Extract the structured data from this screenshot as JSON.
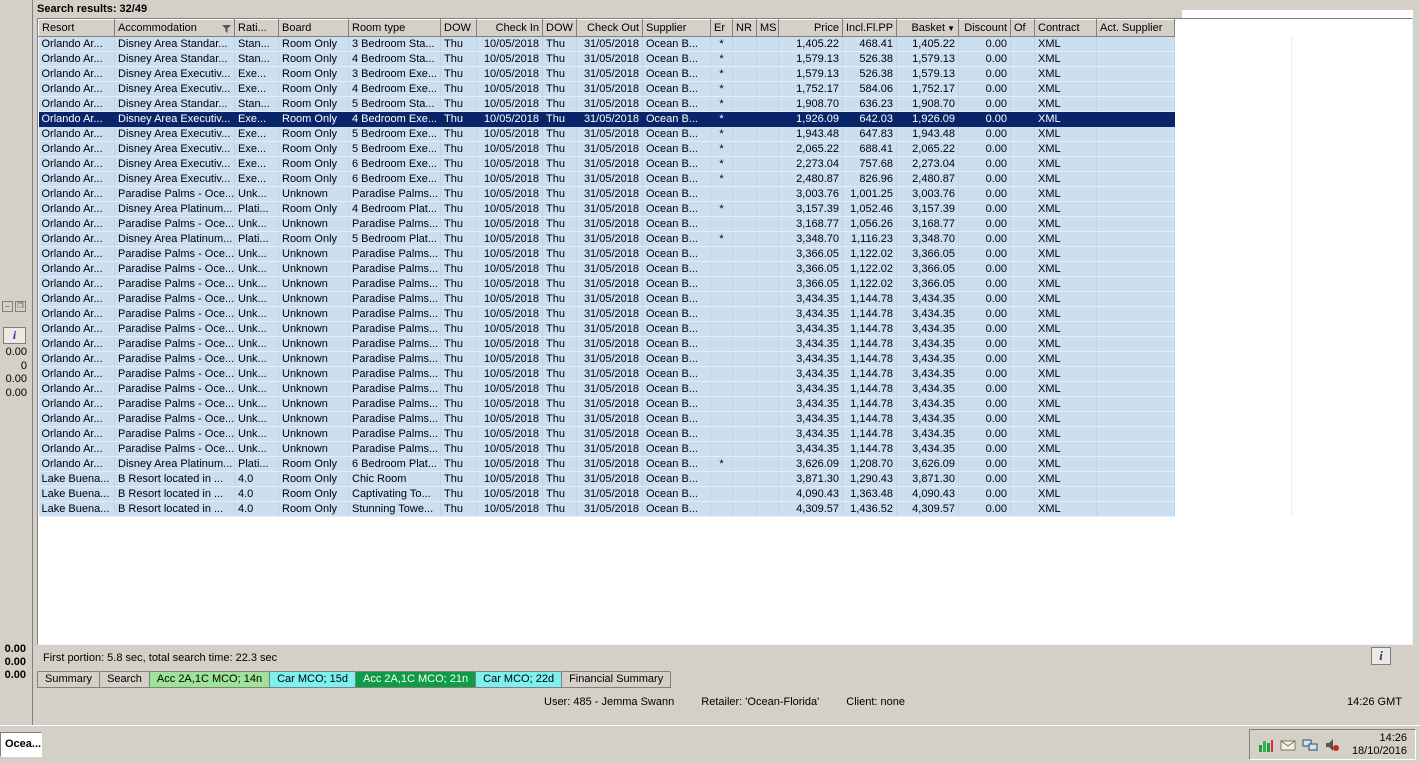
{
  "header": {
    "title": "Search results: 32/49"
  },
  "left_panel": {
    "info_button_label": "i",
    "pin_icon": "panel-pin-icon",
    "restore_icon": "panel-restore-icon",
    "values": [
      "0.00",
      "0",
      "0.00",
      "0.00"
    ],
    "totals": [
      "0.00",
      "0.00",
      "0.00"
    ]
  },
  "table": {
    "columns": [
      {
        "label": "Resort",
        "width": 76,
        "align": "left"
      },
      {
        "label": "Accommodation",
        "width": 120,
        "align": "left",
        "filter_icon": true
      },
      {
        "label": "Rati...",
        "width": 44,
        "align": "left"
      },
      {
        "label": "Board",
        "width": 70,
        "align": "left"
      },
      {
        "label": "Room type",
        "width": 92,
        "align": "left"
      },
      {
        "label": "DOW",
        "width": 36,
        "align": "left"
      },
      {
        "label": "Check In",
        "width": 66,
        "align": "right"
      },
      {
        "label": "DOW",
        "width": 34,
        "align": "left"
      },
      {
        "label": "Check Out",
        "width": 66,
        "align": "right"
      },
      {
        "label": "Supplier",
        "width": 68,
        "align": "left"
      },
      {
        "label": "Er",
        "width": 22,
        "align": "center"
      },
      {
        "label": "NR",
        "width": 24,
        "align": "center"
      },
      {
        "label": "MS",
        "width": 22,
        "align": "center"
      },
      {
        "label": "Price",
        "width": 64,
        "align": "right"
      },
      {
        "label": "Incl.Fl.PP",
        "width": 54,
        "align": "right"
      },
      {
        "label": "Basket",
        "width": 62,
        "align": "right",
        "sort_icon": true
      },
      {
        "label": "Discount",
        "width": 52,
        "align": "right"
      },
      {
        "label": "Of",
        "width": 24,
        "align": "left"
      },
      {
        "label": "Contract",
        "width": 62,
        "align": "left"
      },
      {
        "label": "Act. Supplier",
        "width": 78,
        "align": "left"
      }
    ],
    "selected_row_index": 5,
    "rows": [
      [
        "Orlando Ar...",
        "Disney Area Standar...",
        "Stan...",
        "Room Only",
        "3 Bedroom Sta...",
        "Thu",
        "10/05/2018",
        "Thu",
        "31/05/2018",
        "Ocean B...",
        "*",
        "",
        "",
        "1,405.22",
        "468.41",
        "1,405.22",
        "0.00",
        "",
        "XML",
        ""
      ],
      [
        "Orlando Ar...",
        "Disney Area Standar...",
        "Stan...",
        "Room Only",
        "4 Bedroom Sta...",
        "Thu",
        "10/05/2018",
        "Thu",
        "31/05/2018",
        "Ocean B...",
        "*",
        "",
        "",
        "1,579.13",
        "526.38",
        "1,579.13",
        "0.00",
        "",
        "XML",
        ""
      ],
      [
        "Orlando Ar...",
        "Disney Area Executiv...",
        "Exe...",
        "Room Only",
        "3 Bedroom Exe...",
        "Thu",
        "10/05/2018",
        "Thu",
        "31/05/2018",
        "Ocean B...",
        "*",
        "",
        "",
        "1,579.13",
        "526.38",
        "1,579.13",
        "0.00",
        "",
        "XML",
        ""
      ],
      [
        "Orlando Ar...",
        "Disney Area Executiv...",
        "Exe...",
        "Room Only",
        "4 Bedroom Exe...",
        "Thu",
        "10/05/2018",
        "Thu",
        "31/05/2018",
        "Ocean B...",
        "*",
        "",
        "",
        "1,752.17",
        "584.06",
        "1,752.17",
        "0.00",
        "",
        "XML",
        ""
      ],
      [
        "Orlando Ar...",
        "Disney Area Standar...",
        "Stan...",
        "Room Only",
        "5 Bedroom Sta...",
        "Thu",
        "10/05/2018",
        "Thu",
        "31/05/2018",
        "Ocean B...",
        "*",
        "",
        "",
        "1,908.70",
        "636.23",
        "1,908.70",
        "0.00",
        "",
        "XML",
        ""
      ],
      [
        "Orlando Ar...",
        "Disney Area Executiv...",
        "Exe...",
        "Room Only",
        "4 Bedroom Exe...",
        "Thu",
        "10/05/2018",
        "Thu",
        "31/05/2018",
        "Ocean B...",
        "*",
        "",
        "",
        "1,926.09",
        "642.03",
        "1,926.09",
        "0.00",
        "",
        "XML",
        ""
      ],
      [
        "Orlando Ar...",
        "Disney Area Executiv...",
        "Exe...",
        "Room Only",
        "5 Bedroom Exe...",
        "Thu",
        "10/05/2018",
        "Thu",
        "31/05/2018",
        "Ocean B...",
        "*",
        "",
        "",
        "1,943.48",
        "647.83",
        "1,943.48",
        "0.00",
        "",
        "XML",
        ""
      ],
      [
        "Orlando Ar...",
        "Disney Area Executiv...",
        "Exe...",
        "Room Only",
        "5 Bedroom Exe...",
        "Thu",
        "10/05/2018",
        "Thu",
        "31/05/2018",
        "Ocean B...",
        "*",
        "",
        "",
        "2,065.22",
        "688.41",
        "2,065.22",
        "0.00",
        "",
        "XML",
        ""
      ],
      [
        "Orlando Ar...",
        "Disney Area Executiv...",
        "Exe...",
        "Room Only",
        "6 Bedroom Exe...",
        "Thu",
        "10/05/2018",
        "Thu",
        "31/05/2018",
        "Ocean B...",
        "*",
        "",
        "",
        "2,273.04",
        "757.68",
        "2,273.04",
        "0.00",
        "",
        "XML",
        ""
      ],
      [
        "Orlando Ar...",
        "Disney Area Executiv...",
        "Exe...",
        "Room Only",
        "6 Bedroom Exe...",
        "Thu",
        "10/05/2018",
        "Thu",
        "31/05/2018",
        "Ocean B...",
        "*",
        "",
        "",
        "2,480.87",
        "826.96",
        "2,480.87",
        "0.00",
        "",
        "XML",
        ""
      ],
      [
        "Orlando Ar...",
        "Paradise Palms - Oce...",
        "Unk...",
        "Unknown",
        "Paradise Palms...",
        "Thu",
        "10/05/2018",
        "Thu",
        "31/05/2018",
        "Ocean B...",
        "",
        "",
        "",
        "3,003.76",
        "1,001.25",
        "3,003.76",
        "0.00",
        "",
        "XML",
        ""
      ],
      [
        "Orlando Ar...",
        "Disney Area Platinum...",
        "Plati...",
        "Room Only",
        "4 Bedroom Plat...",
        "Thu",
        "10/05/2018",
        "Thu",
        "31/05/2018",
        "Ocean B...",
        "*",
        "",
        "",
        "3,157.39",
        "1,052.46",
        "3,157.39",
        "0.00",
        "",
        "XML",
        ""
      ],
      [
        "Orlando Ar...",
        "Paradise Palms - Oce...",
        "Unk...",
        "Unknown",
        "Paradise Palms...",
        "Thu",
        "10/05/2018",
        "Thu",
        "31/05/2018",
        "Ocean B...",
        "",
        "",
        "",
        "3,168.77",
        "1,056.26",
        "3,168.77",
        "0.00",
        "",
        "XML",
        ""
      ],
      [
        "Orlando Ar...",
        "Disney Area Platinum...",
        "Plati...",
        "Room Only",
        "5 Bedroom Plat...",
        "Thu",
        "10/05/2018",
        "Thu",
        "31/05/2018",
        "Ocean B...",
        "*",
        "",
        "",
        "3,348.70",
        "1,116.23",
        "3,348.70",
        "0.00",
        "",
        "XML",
        ""
      ],
      [
        "Orlando Ar...",
        "Paradise Palms - Oce...",
        "Unk...",
        "Unknown",
        "Paradise Palms...",
        "Thu",
        "10/05/2018",
        "Thu",
        "31/05/2018",
        "Ocean B...",
        "",
        "",
        "",
        "3,366.05",
        "1,122.02",
        "3,366.05",
        "0.00",
        "",
        "XML",
        ""
      ],
      [
        "Orlando Ar...",
        "Paradise Palms - Oce...",
        "Unk...",
        "Unknown",
        "Paradise Palms...",
        "Thu",
        "10/05/2018",
        "Thu",
        "31/05/2018",
        "Ocean B...",
        "",
        "",
        "",
        "3,366.05",
        "1,122.02",
        "3,366.05",
        "0.00",
        "",
        "XML",
        ""
      ],
      [
        "Orlando Ar...",
        "Paradise Palms - Oce...",
        "Unk...",
        "Unknown",
        "Paradise Palms...",
        "Thu",
        "10/05/2018",
        "Thu",
        "31/05/2018",
        "Ocean B...",
        "",
        "",
        "",
        "3,366.05",
        "1,122.02",
        "3,366.05",
        "0.00",
        "",
        "XML",
        ""
      ],
      [
        "Orlando Ar...",
        "Paradise Palms - Oce...",
        "Unk...",
        "Unknown",
        "Paradise Palms...",
        "Thu",
        "10/05/2018",
        "Thu",
        "31/05/2018",
        "Ocean B...",
        "",
        "",
        "",
        "3,434.35",
        "1,144.78",
        "3,434.35",
        "0.00",
        "",
        "XML",
        ""
      ],
      [
        "Orlando Ar...",
        "Paradise Palms - Oce...",
        "Unk...",
        "Unknown",
        "Paradise Palms...",
        "Thu",
        "10/05/2018",
        "Thu",
        "31/05/2018",
        "Ocean B...",
        "",
        "",
        "",
        "3,434.35",
        "1,144.78",
        "3,434.35",
        "0.00",
        "",
        "XML",
        ""
      ],
      [
        "Orlando Ar...",
        "Paradise Palms - Oce...",
        "Unk...",
        "Unknown",
        "Paradise Palms...",
        "Thu",
        "10/05/2018",
        "Thu",
        "31/05/2018",
        "Ocean B...",
        "",
        "",
        "",
        "3,434.35",
        "1,144.78",
        "3,434.35",
        "0.00",
        "",
        "XML",
        ""
      ],
      [
        "Orlando Ar...",
        "Paradise Palms - Oce...",
        "Unk...",
        "Unknown",
        "Paradise Palms...",
        "Thu",
        "10/05/2018",
        "Thu",
        "31/05/2018",
        "Ocean B...",
        "",
        "",
        "",
        "3,434.35",
        "1,144.78",
        "3,434.35",
        "0.00",
        "",
        "XML",
        ""
      ],
      [
        "Orlando Ar...",
        "Paradise Palms - Oce...",
        "Unk...",
        "Unknown",
        "Paradise Palms...",
        "Thu",
        "10/05/2018",
        "Thu",
        "31/05/2018",
        "Ocean B...",
        "",
        "",
        "",
        "3,434.35",
        "1,144.78",
        "3,434.35",
        "0.00",
        "",
        "XML",
        ""
      ],
      [
        "Orlando Ar...",
        "Paradise Palms - Oce...",
        "Unk...",
        "Unknown",
        "Paradise Palms...",
        "Thu",
        "10/05/2018",
        "Thu",
        "31/05/2018",
        "Ocean B...",
        "",
        "",
        "",
        "3,434.35",
        "1,144.78",
        "3,434.35",
        "0.00",
        "",
        "XML",
        ""
      ],
      [
        "Orlando Ar...",
        "Paradise Palms - Oce...",
        "Unk...",
        "Unknown",
        "Paradise Palms...",
        "Thu",
        "10/05/2018",
        "Thu",
        "31/05/2018",
        "Ocean B...",
        "",
        "",
        "",
        "3,434.35",
        "1,144.78",
        "3,434.35",
        "0.00",
        "",
        "XML",
        ""
      ],
      [
        "Orlando Ar...",
        "Paradise Palms - Oce...",
        "Unk...",
        "Unknown",
        "Paradise Palms...",
        "Thu",
        "10/05/2018",
        "Thu",
        "31/05/2018",
        "Ocean B...",
        "",
        "",
        "",
        "3,434.35",
        "1,144.78",
        "3,434.35",
        "0.00",
        "",
        "XML",
        ""
      ],
      [
        "Orlando Ar...",
        "Paradise Palms - Oce...",
        "Unk...",
        "Unknown",
        "Paradise Palms...",
        "Thu",
        "10/05/2018",
        "Thu",
        "31/05/2018",
        "Ocean B...",
        "",
        "",
        "",
        "3,434.35",
        "1,144.78",
        "3,434.35",
        "0.00",
        "",
        "XML",
        ""
      ],
      [
        "Orlando Ar...",
        "Paradise Palms - Oce...",
        "Unk...",
        "Unknown",
        "Paradise Palms...",
        "Thu",
        "10/05/2018",
        "Thu",
        "31/05/2018",
        "Ocean B...",
        "",
        "",
        "",
        "3,434.35",
        "1,144.78",
        "3,434.35",
        "0.00",
        "",
        "XML",
        ""
      ],
      [
        "Orlando Ar...",
        "Paradise Palms - Oce...",
        "Unk...",
        "Unknown",
        "Paradise Palms...",
        "Thu",
        "10/05/2018",
        "Thu",
        "31/05/2018",
        "Ocean B...",
        "",
        "",
        "",
        "3,434.35",
        "1,144.78",
        "3,434.35",
        "0.00",
        "",
        "XML",
        ""
      ],
      [
        "Orlando Ar...",
        "Disney Area Platinum...",
        "Plati...",
        "Room Only",
        "6 Bedroom Plat...",
        "Thu",
        "10/05/2018",
        "Thu",
        "31/05/2018",
        "Ocean B...",
        "*",
        "",
        "",
        "3,626.09",
        "1,208.70",
        "3,626.09",
        "0.00",
        "",
        "XML",
        ""
      ],
      [
        "Lake Buena...",
        "B Resort located in ...",
        "4.0",
        "Room Only",
        "Chic Room",
        "Thu",
        "10/05/2018",
        "Thu",
        "31/05/2018",
        "Ocean B...",
        "",
        "",
        "",
        "3,871.30",
        "1,290.43",
        "3,871.30",
        "0.00",
        "",
        "XML",
        ""
      ],
      [
        "Lake Buena...",
        "B Resort located in ...",
        "4.0",
        "Room Only",
        "Captivating To...",
        "Thu",
        "10/05/2018",
        "Thu",
        "31/05/2018",
        "Ocean B...",
        "",
        "",
        "",
        "4,090.43",
        "1,363.48",
        "4,090.43",
        "0.00",
        "",
        "XML",
        ""
      ],
      [
        "Lake Buena...",
        "B Resort located in ...",
        "4.0",
        "Room Only",
        "Stunning Towe...",
        "Thu",
        "10/05/2018",
        "Thu",
        "31/05/2018",
        "Ocean B...",
        "",
        "",
        "",
        "4,309.57",
        "1,436.52",
        "4,309.57",
        "0.00",
        "",
        "XML",
        ""
      ]
    ]
  },
  "footer": {
    "timing": "First portion: 5.8 sec, total search time: 22.3 sec",
    "info_button_label": "i"
  },
  "tabs": [
    {
      "label": "Summary",
      "style": "plain"
    },
    {
      "label": "Search",
      "style": "plain"
    },
    {
      "label": "Acc 2A,1C MCO; 14n",
      "style": "green_light"
    },
    {
      "label": "Car MCO; 15d",
      "style": "cyan"
    },
    {
      "label": "Acc 2A,1C MCO; 21n",
      "style": "green_dark"
    },
    {
      "label": "Car MCO; 22d",
      "style": "cyan"
    },
    {
      "label": "Financial Summary",
      "style": "plain"
    }
  ],
  "user_bar": {
    "user": "User: 485 - Jemma Swann",
    "retailer": "Retailer: 'Ocean-Florida'",
    "client": "Client: none",
    "time": "14:26 GMT"
  },
  "taskbar": {
    "window_button": "Ocea...",
    "tray_icons": [
      "chart-icon",
      "mail-icon",
      "network-icon",
      "audio-icon"
    ],
    "time": "14:26",
    "date": "18/10/2016"
  },
  "colors": {
    "selected_row": "#0a246a",
    "row_blue": "#cbdff0",
    "chrome_gray": "#d4d0c8",
    "tab_green_light": "#9fe39b",
    "tab_cyan": "#7df0f0",
    "tab_green_dark": "#0e9c46"
  }
}
